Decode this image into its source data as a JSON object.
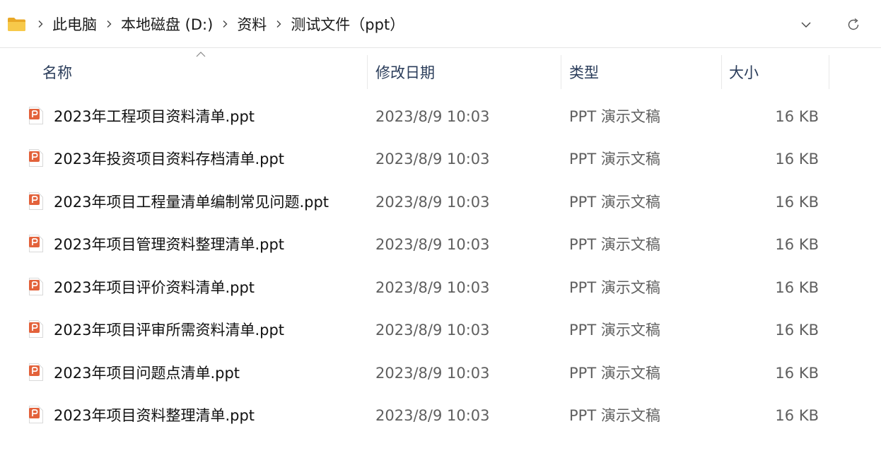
{
  "breadcrumb": {
    "items": [
      "此电脑",
      "本地磁盘 (D:)",
      "资料",
      "测试文件（ppt）"
    ]
  },
  "columns": {
    "name": "名称",
    "modified": "修改日期",
    "type": "类型",
    "size": "大小"
  },
  "files": [
    {
      "name": "2023年工程项目资料清单.ppt",
      "modified": "2023/8/9 10:03",
      "type": "PPT 演示文稿",
      "size": "16 KB"
    },
    {
      "name": "2023年投资项目资料存档清单.ppt",
      "modified": "2023/8/9 10:03",
      "type": "PPT 演示文稿",
      "size": "16 KB"
    },
    {
      "name": "2023年项目工程量清单编制常见问题.ppt",
      "modified": "2023/8/9 10:03",
      "type": "PPT 演示文稿",
      "size": "16 KB"
    },
    {
      "name": "2023年项目管理资料整理清单.ppt",
      "modified": "2023/8/9 10:03",
      "type": "PPT 演示文稿",
      "size": "16 KB"
    },
    {
      "name": "2023年项目评价资料清单.ppt",
      "modified": "2023/8/9 10:03",
      "type": "PPT 演示文稿",
      "size": "16 KB"
    },
    {
      "name": "2023年项目评审所需资料清单.ppt",
      "modified": "2023/8/9 10:03",
      "type": "PPT 演示文稿",
      "size": "16 KB"
    },
    {
      "name": "2023年项目问题点清单.ppt",
      "modified": "2023/8/9 10:03",
      "type": "PPT 演示文稿",
      "size": "16 KB"
    },
    {
      "name": "2023年项目资料整理清单.ppt",
      "modified": "2023/8/9 10:03",
      "type": "PPT 演示文稿",
      "size": "16 KB"
    }
  ],
  "colors": {
    "folder": "#f3c14b",
    "ppt_icon": "#e3623b",
    "header_text": "#2a3c5a",
    "secondary_text": "#5f5f5f"
  },
  "icons": {
    "folder": "folder-icon",
    "separator": "chevron-right-icon",
    "dropdown": "chevron-down-icon",
    "refresh": "refresh-icon",
    "sort": "sort-ascending-icon",
    "file": "ppt-file-icon"
  }
}
